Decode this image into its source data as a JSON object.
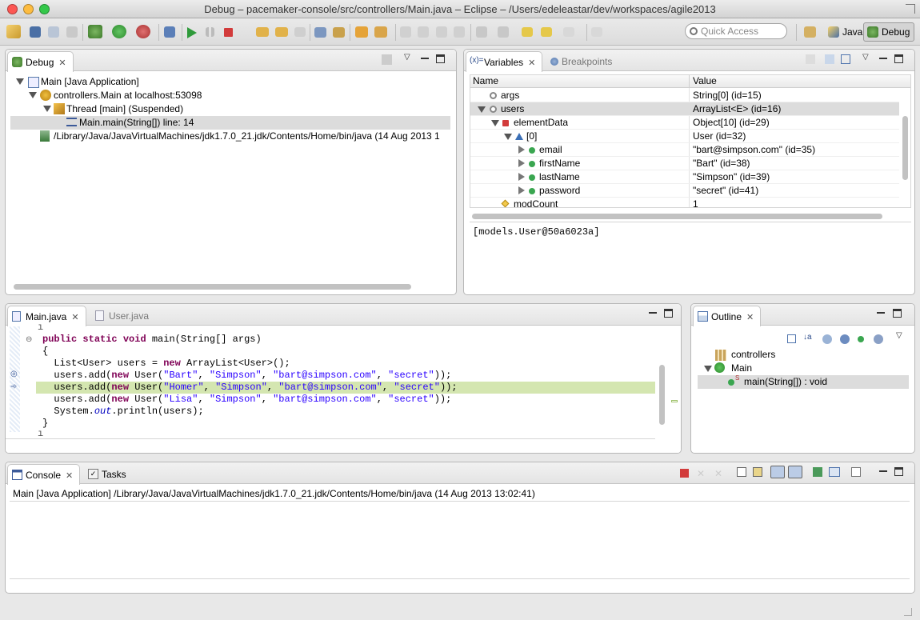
{
  "window": {
    "title": "Debug – pacemaker-console/src/controllers/Main.java – Eclipse – /Users/edeleastar/dev/workspaces/agile2013"
  },
  "toolbar": {
    "quick_access_placeholder": "Quick Access",
    "perspectives": [
      {
        "label": "Java",
        "active": false
      },
      {
        "label": "Debug",
        "active": true
      }
    ]
  },
  "debug_view": {
    "tab_label": "Debug",
    "tree": [
      {
        "label": "Main [Java Application]"
      },
      {
        "label": "controllers.Main at localhost:53098"
      },
      {
        "label": "Thread [main] (Suspended)"
      },
      {
        "label": "Main.main(String[]) line: 14"
      },
      {
        "label": "/Library/Java/JavaVirtualMachines/jdk1.7.0_21.jdk/Contents/Home/bin/java (14 Aug 2013 1"
      }
    ]
  },
  "variables_view": {
    "tabs": [
      "Variables",
      "Breakpoints"
    ],
    "columns": [
      "Name",
      "Value"
    ],
    "rows": [
      {
        "name": "args",
        "value": "String[0]  (id=15)"
      },
      {
        "name": "users",
        "value": "ArrayList<E>  (id=16)"
      },
      {
        "name": "elementData",
        "value": "Object[10]  (id=29)"
      },
      {
        "name": "[0]",
        "value": "User  (id=32)"
      },
      {
        "name": "email",
        "value": "\"bart@simpson.com\" (id=35)"
      },
      {
        "name": "firstName",
        "value": "\"Bart\" (id=38)"
      },
      {
        "name": "lastName",
        "value": "\"Simpson\" (id=39)"
      },
      {
        "name": "password",
        "value": "\"secret\" (id=41)"
      },
      {
        "name": "modCount",
        "value": "1"
      }
    ],
    "detail": "[models.User@50a6023a]"
  },
  "editor": {
    "tabs": [
      "Main.java",
      "User.java"
    ],
    "lines": [
      "public static void main(String[] args)",
      "{",
      "  List<User> users = new ArrayList<User>();",
      "  users.add(new User(\"Bart\", \"Simpson\", \"bart@simpson.com\", \"secret\"));",
      "  users.add(new User(\"Homer\", \"Simpson\", \"bart@simpson.com\", \"secret\"));",
      "  users.add(new User(\"Lisa\", \"Simpson\", \"bart@simpson.com\", \"secret\"));",
      "  System.out.println(users);",
      "}"
    ]
  },
  "outline": {
    "tab_label": "Outline",
    "items": [
      {
        "label": "controllers"
      },
      {
        "label": "Main"
      },
      {
        "label": "main(String[]) : void"
      }
    ]
  },
  "console": {
    "tabs": [
      "Console",
      "Tasks"
    ],
    "header": "Main [Java Application] /Library/Java/JavaVirtualMachines/jdk1.7.0_21.jdk/Contents/Home/bin/java (14 Aug 2013 13:02:41)"
  },
  "colors": {
    "highlight_line": "#d4e6b0",
    "selection": "#dcdcdc",
    "keyword": "#7f0055",
    "string": "#2a00ff"
  }
}
